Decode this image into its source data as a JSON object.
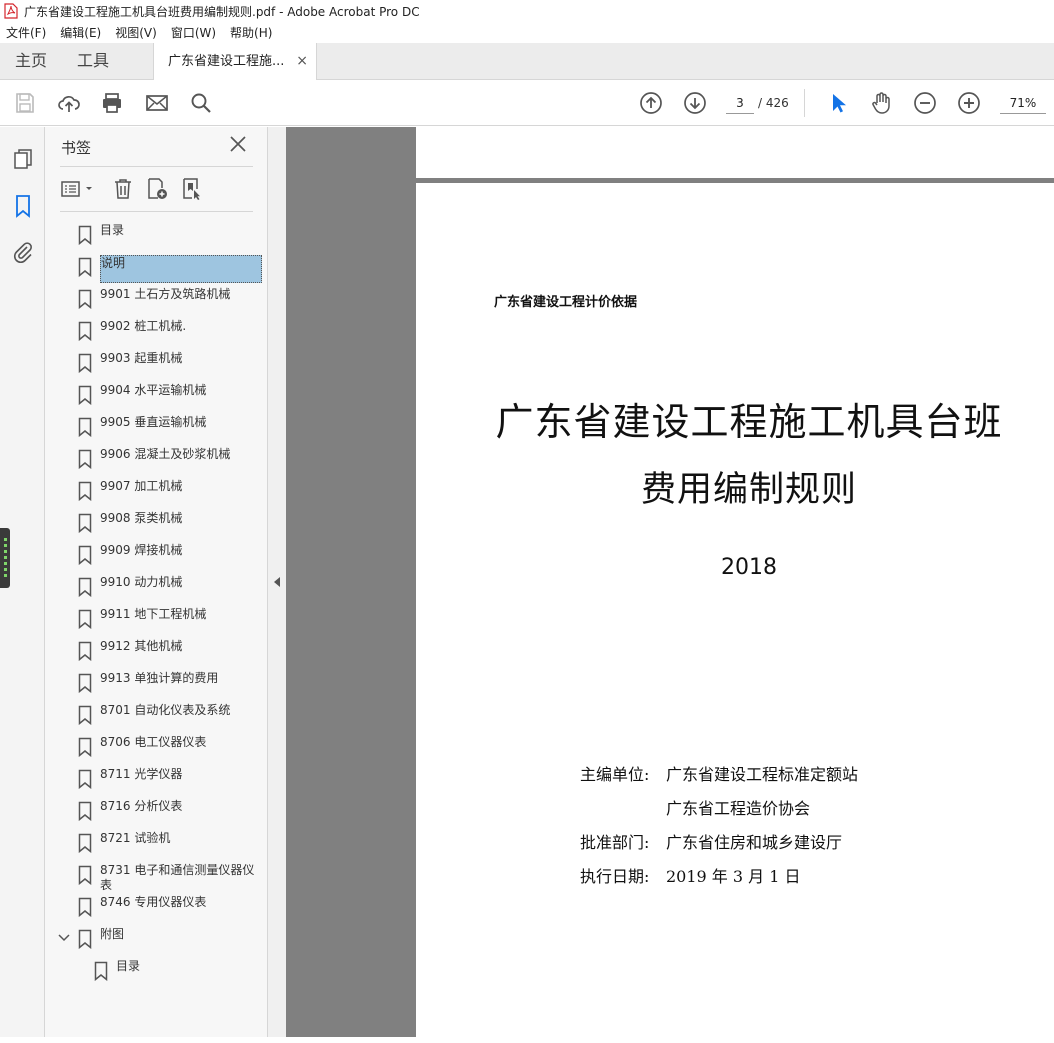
{
  "window": {
    "title": "广东省建设工程施工机具台班费用编制规则.pdf - Adobe Acrobat Pro DC"
  },
  "menu": [
    "文件(F)",
    "编辑(E)",
    "视图(V)",
    "窗口(W)",
    "帮助(H)"
  ],
  "tabs": {
    "home": "主页",
    "tools": "工具",
    "document": "广东省建设工程施...",
    "close": "×"
  },
  "toolbar": {
    "icons": [
      "save-icon",
      "cloud-upload-icon",
      "print-icon",
      "email-icon",
      "search-icon",
      "prev-page-icon",
      "next-page-icon",
      "select-arrow-icon",
      "hand-icon",
      "zoom-out-icon",
      "zoom-in-icon"
    ],
    "page_current": "3",
    "page_total": "/ 426",
    "zoom": "71%"
  },
  "bookmarks": {
    "title": "书签",
    "items": [
      {
        "label": "目录"
      },
      {
        "label": "说明"
      },
      {
        "label": "9901 土石方及筑路机械"
      },
      {
        "label": "9902 桩工机械."
      },
      {
        "label": "9903 起重机械"
      },
      {
        "label": "9904 水平运输机械"
      },
      {
        "label": "9905 垂直运输机械"
      },
      {
        "label": "9906 混凝土及砂浆机械"
      },
      {
        "label": "9907 加工机械"
      },
      {
        "label": "9908 泵类机械"
      },
      {
        "label": "9909 焊接机械"
      },
      {
        "label": "9910 动力机械"
      },
      {
        "label": "9911 地下工程机械"
      },
      {
        "label": "9912 其他机械"
      },
      {
        "label": "9913 单独计算的费用"
      },
      {
        "label": "8701 自动化仪表及系统"
      },
      {
        "label": "8706 电工仪器仪表"
      },
      {
        "label": "8711 光学仪器"
      },
      {
        "label": "8716 分析仪表"
      },
      {
        "label": "8721 试验机"
      },
      {
        "label": "8731 电子和通信测量仪器仪表"
      },
      {
        "label": "8746 专用仪器仪表"
      },
      {
        "label": "附图"
      },
      {
        "label": "目录"
      }
    ],
    "selected_index": 1
  },
  "document": {
    "basis": "广东省建设工程计价依据",
    "title_line1": "广东省建设工程施工机具台班",
    "title_line2": "费用编制规则",
    "year": "2018",
    "editor_label": "主编单位:",
    "editor1": "广东省建设工程标准定额站",
    "editor2": "广东省工程造价协会",
    "approver_label": "批准部门:",
    "approver": "广东省住房和城乡建设厅",
    "date_label": "执行日期:",
    "date": "2019 年 3 月 1 日"
  },
  "colors": {
    "selection": "#9ec5e0",
    "accent": "#1473e6",
    "viewer_bg": "#808080"
  }
}
